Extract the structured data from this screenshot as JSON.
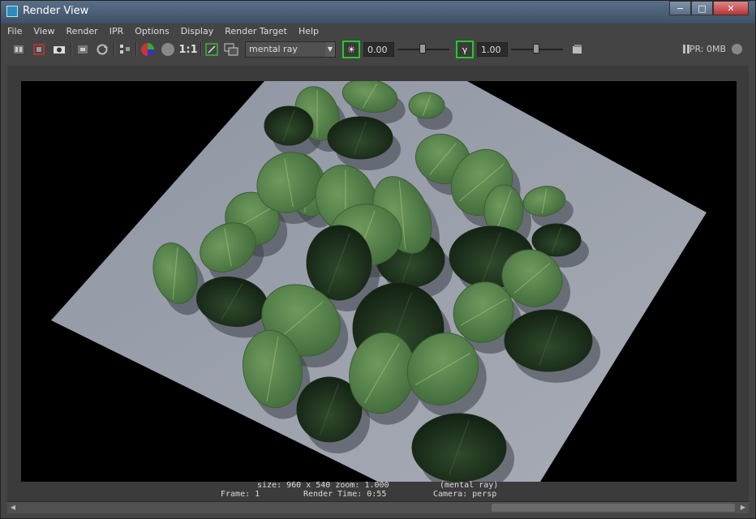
{
  "window": {
    "title": "Render View",
    "controls": {
      "minimize": "−",
      "maximize": "□",
      "close": "✕"
    }
  },
  "menu": [
    "File",
    "View",
    "Render",
    "IPR",
    "Options",
    "Display",
    "Render Target",
    "Help"
  ],
  "toolbar": {
    "icons": [
      "redo-render-icon",
      "ipr-render-icon",
      "snapshot-icon",
      "region-render-icon",
      "refresh-ipr-icon",
      "keep-image-icon",
      "rgb-channels-icon",
      "alpha-channel-icon",
      "real-size-icon",
      "display-region-icon",
      "sync-icon"
    ],
    "real_size_label": "1:1",
    "renderer": "mental ray",
    "exposure": {
      "value": "0.00",
      "glyph": "☀"
    },
    "gamma": {
      "value": "1.00",
      "glyph": "γ"
    },
    "ipr_status": "IPR: 0MB"
  },
  "render_info": {
    "line1": "size: 960 x 540 zoom: 1.000",
    "renderer_note": "(mental ray)",
    "frame": "Frame: 1",
    "render_time": "Render Time: 0:55",
    "camera": "Camera: persp"
  }
}
